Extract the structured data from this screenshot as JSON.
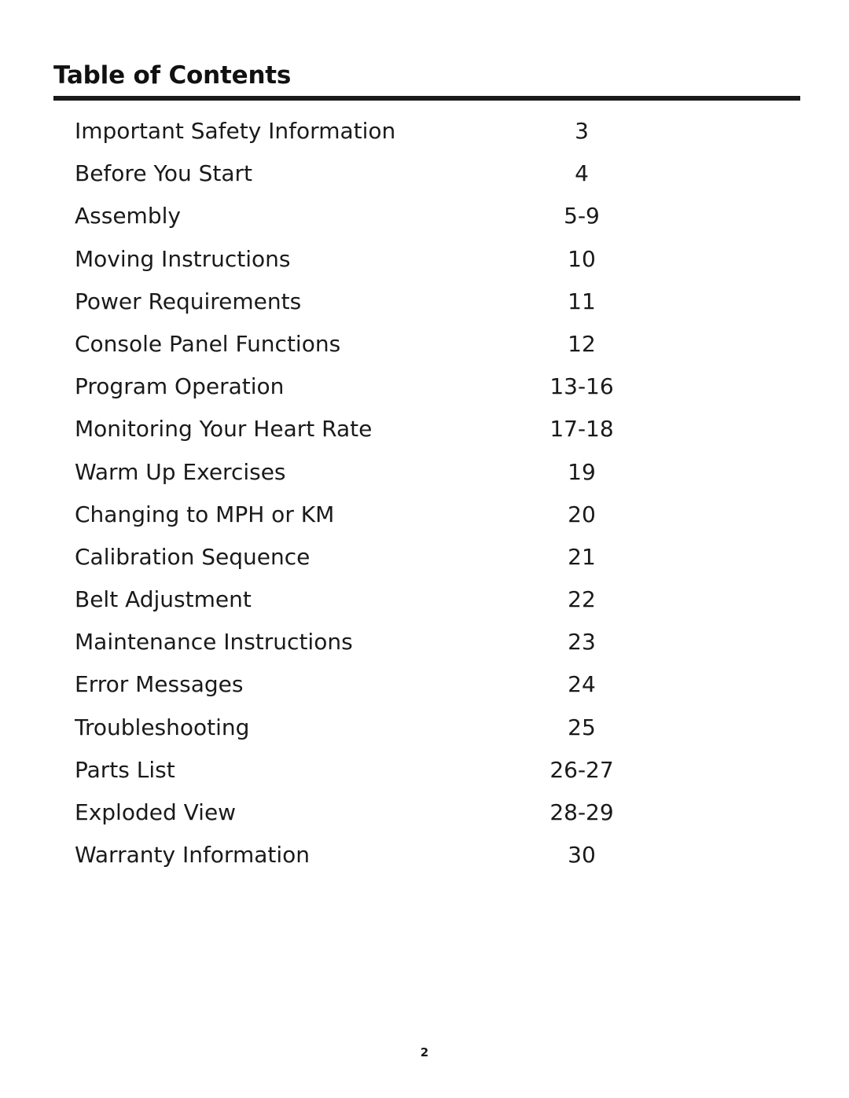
{
  "document": {
    "heading": "Table of Contents",
    "page_number": "2",
    "entries": [
      {
        "label": "Important Safety Information",
        "page": "3"
      },
      {
        "label": "Before You Start",
        "page": "4"
      },
      {
        "label": "Assembly",
        "page": "5-9"
      },
      {
        "label": "Moving Instructions",
        "page": "10"
      },
      {
        "label": "Power Requirements",
        "page": "11"
      },
      {
        "label": "Console Panel Functions",
        "page": "12"
      },
      {
        "label": "Program Operation",
        "page": "13-16"
      },
      {
        "label": "Monitoring Your Heart Rate",
        "page": "17-18"
      },
      {
        "label": "Warm Up Exercises",
        "page": "19"
      },
      {
        "label": "Changing to MPH or KM",
        "page": "20"
      },
      {
        "label": "Calibration Sequence",
        "page": "21"
      },
      {
        "label": "Belt Adjustment",
        "page": "22"
      },
      {
        "label": "Maintenance Instructions",
        "page": "23"
      },
      {
        "label": "Error Messages",
        "page": "24"
      },
      {
        "label": "Troubleshooting",
        "page": "25"
      },
      {
        "label": "Parts List",
        "page": "26-27"
      },
      {
        "label": "Exploded View",
        "page": "28-29"
      },
      {
        "label": "Warranty Information",
        "page": "30"
      }
    ]
  }
}
